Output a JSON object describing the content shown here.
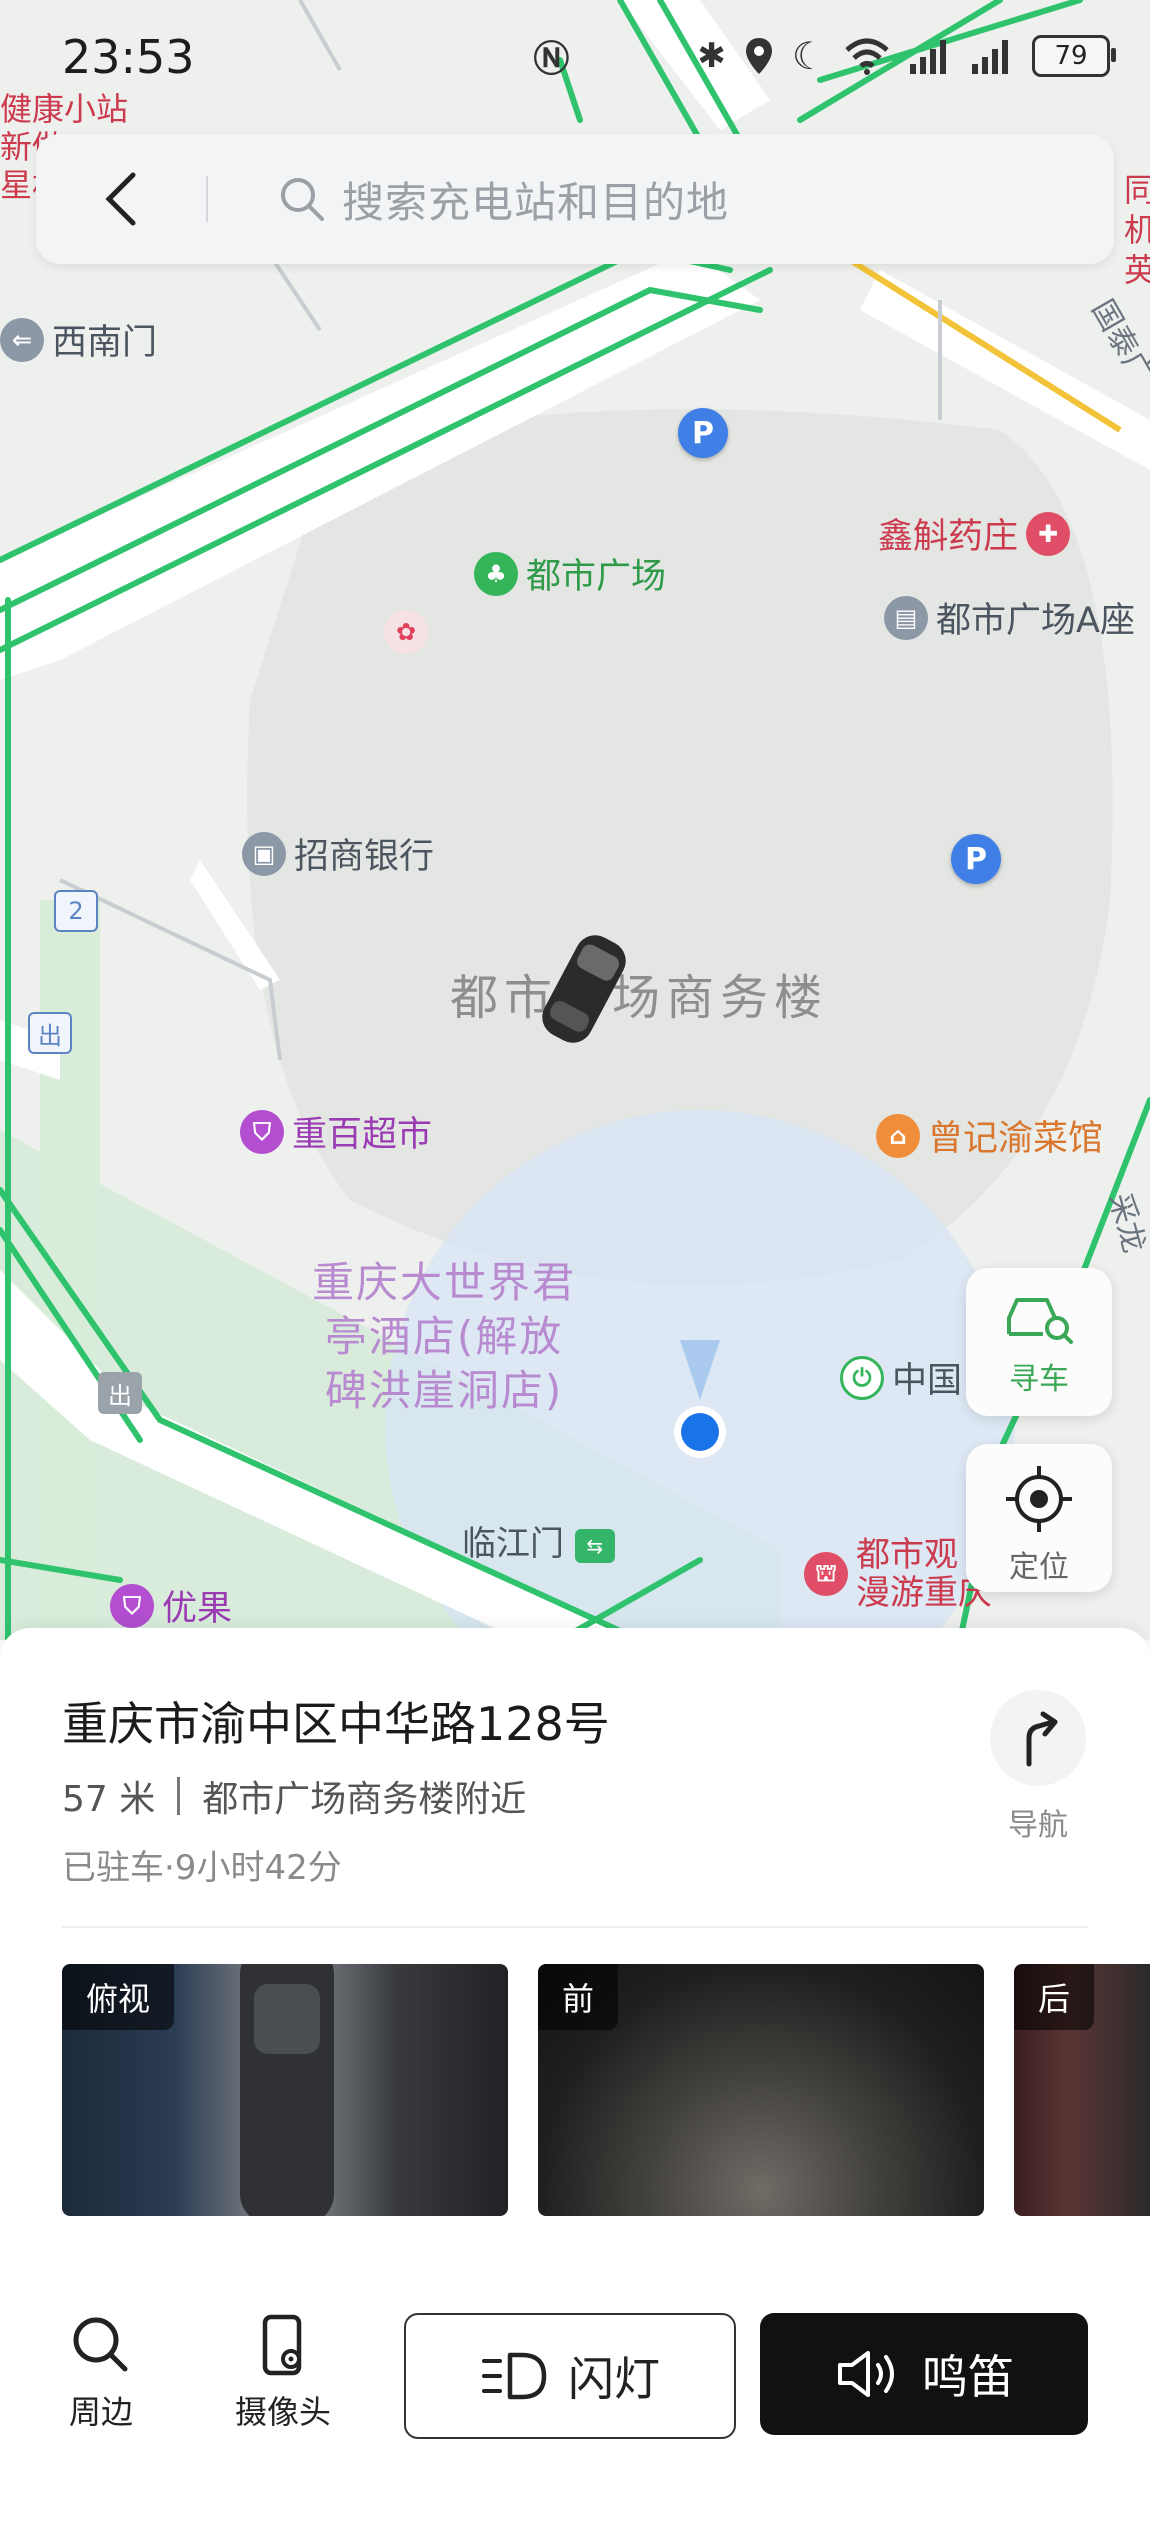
{
  "status_bar": {
    "time": "23:53",
    "battery": "79"
  },
  "search": {
    "placeholder": "搜索充电站和目的地"
  },
  "map": {
    "big_area_label": "都市广场商务楼",
    "hotel_label": "重庆大世界君\n亭酒店(解放\n碑洪崖洞店)",
    "pois": {
      "xinan_gate": "西南门",
      "dushi_plaza": "都市广场",
      "xinhu_pharmacy": "鑫斛药庄",
      "dushi_plaza_a": "都市广场A座",
      "cmb_bank": "招商银行",
      "chongbai_market": "重百超市",
      "zengji_restaurant": "曾记渝菜馆",
      "china_label": "中国",
      "linjiang_gate": "临江门",
      "dushi_sightseeing": "都市观\n漫游重庆",
      "youguo": "优果",
      "health_station": "健康小站\n新做\n星杉",
      "top_right_partial": "同\n机\n英",
      "road_guotai": "国泰广",
      "road_right": "采龙",
      "exit_1": "出",
      "exit_2": "出",
      "route_2": "2"
    }
  },
  "floating": {
    "find_car": "寻车",
    "locate": "定位"
  },
  "vehicle": {
    "address": "重庆市渝中区中华路128号",
    "distance": "57 米",
    "nearby": "都市广场商务楼附近",
    "parked_status": "已驻车·9小时42分",
    "navigate_label": "导航"
  },
  "cameras": [
    {
      "label": "俯视"
    },
    {
      "label": "前"
    },
    {
      "label": "后"
    }
  ],
  "actions": {
    "nearby": "周边",
    "camera": "摄像头",
    "flash": "闪灯",
    "horn": "鸣笛"
  },
  "colors": {
    "route_green": "#2ec36c",
    "user_dot": "#1a73e8",
    "accent_green": "#3aa856"
  }
}
